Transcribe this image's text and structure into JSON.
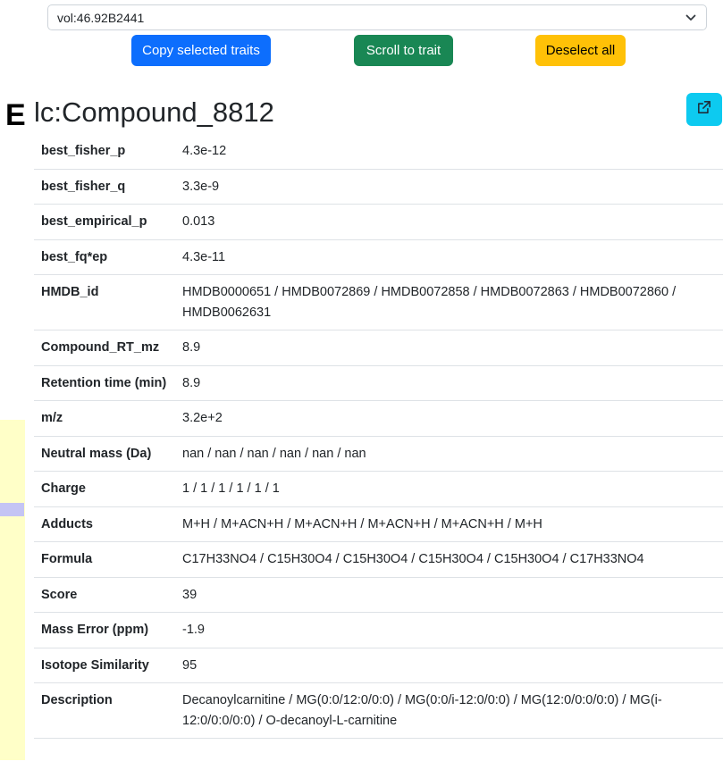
{
  "search": {
    "value": "vol:46.92B2441"
  },
  "toolbar": {
    "copy_label": "Copy selected traits",
    "scroll_label": "Scroll to trait",
    "deselect_label": "Deselect all"
  },
  "section": {
    "letter": "E",
    "title": "lc:Compound_8812"
  },
  "icons": {
    "dropdown": "chevron-down-icon",
    "external": "external-link-icon"
  },
  "colors": {
    "primary": "#0d6efd",
    "success": "#198754",
    "warning": "#ffc107",
    "info": "#0dcaf0",
    "side_panel": "#ffffc8",
    "side_marker": "#c4c4f4"
  },
  "traits": [
    {
      "key": "best_fisher_p",
      "value": "4.3e-12"
    },
    {
      "key": "best_fisher_q",
      "value": "3.3e-9"
    },
    {
      "key": "best_empirical_p",
      "value": "0.013"
    },
    {
      "key": "best_fq*ep",
      "value": "4.3e-11"
    },
    {
      "key": "HMDB_id",
      "value": "HMDB0000651 / HMDB0072869 / HMDB0072858 / HMDB0072863 / HMDB0072860 / HMDB0062631"
    },
    {
      "key": "Compound_RT_mz",
      "value": "8.9"
    },
    {
      "key": "Retention time (min)",
      "value": "8.9"
    },
    {
      "key": "m/z",
      "value": "3.2e+2"
    },
    {
      "key": "Neutral mass (Da)",
      "value": "nan / nan / nan / nan / nan / nan"
    },
    {
      "key": "Charge",
      "value": "1 / 1 / 1 / 1 / 1 / 1"
    },
    {
      "key": "Adducts",
      "value": "M+H / M+ACN+H / M+ACN+H / M+ACN+H / M+ACN+H / M+H"
    },
    {
      "key": "Formula",
      "value": "C17H33NO4 / C15H30O4 / C15H30O4 / C15H30O4 / C15H30O4 / C17H33NO4"
    },
    {
      "key": "Score",
      "value": "39"
    },
    {
      "key": "Mass Error (ppm)",
      "value": "-1.9"
    },
    {
      "key": "Isotope Similarity",
      "value": "95"
    },
    {
      "key": "Description",
      "value": "Decanoylcarnitine / MG(0:0/12:0/0:0) / MG(0:0/i-12:0/0:0) / MG(12:0/0:0/0:0) / MG(i-12:0/0:0/0:0) / O-decanoyl-L-carnitine"
    }
  ]
}
